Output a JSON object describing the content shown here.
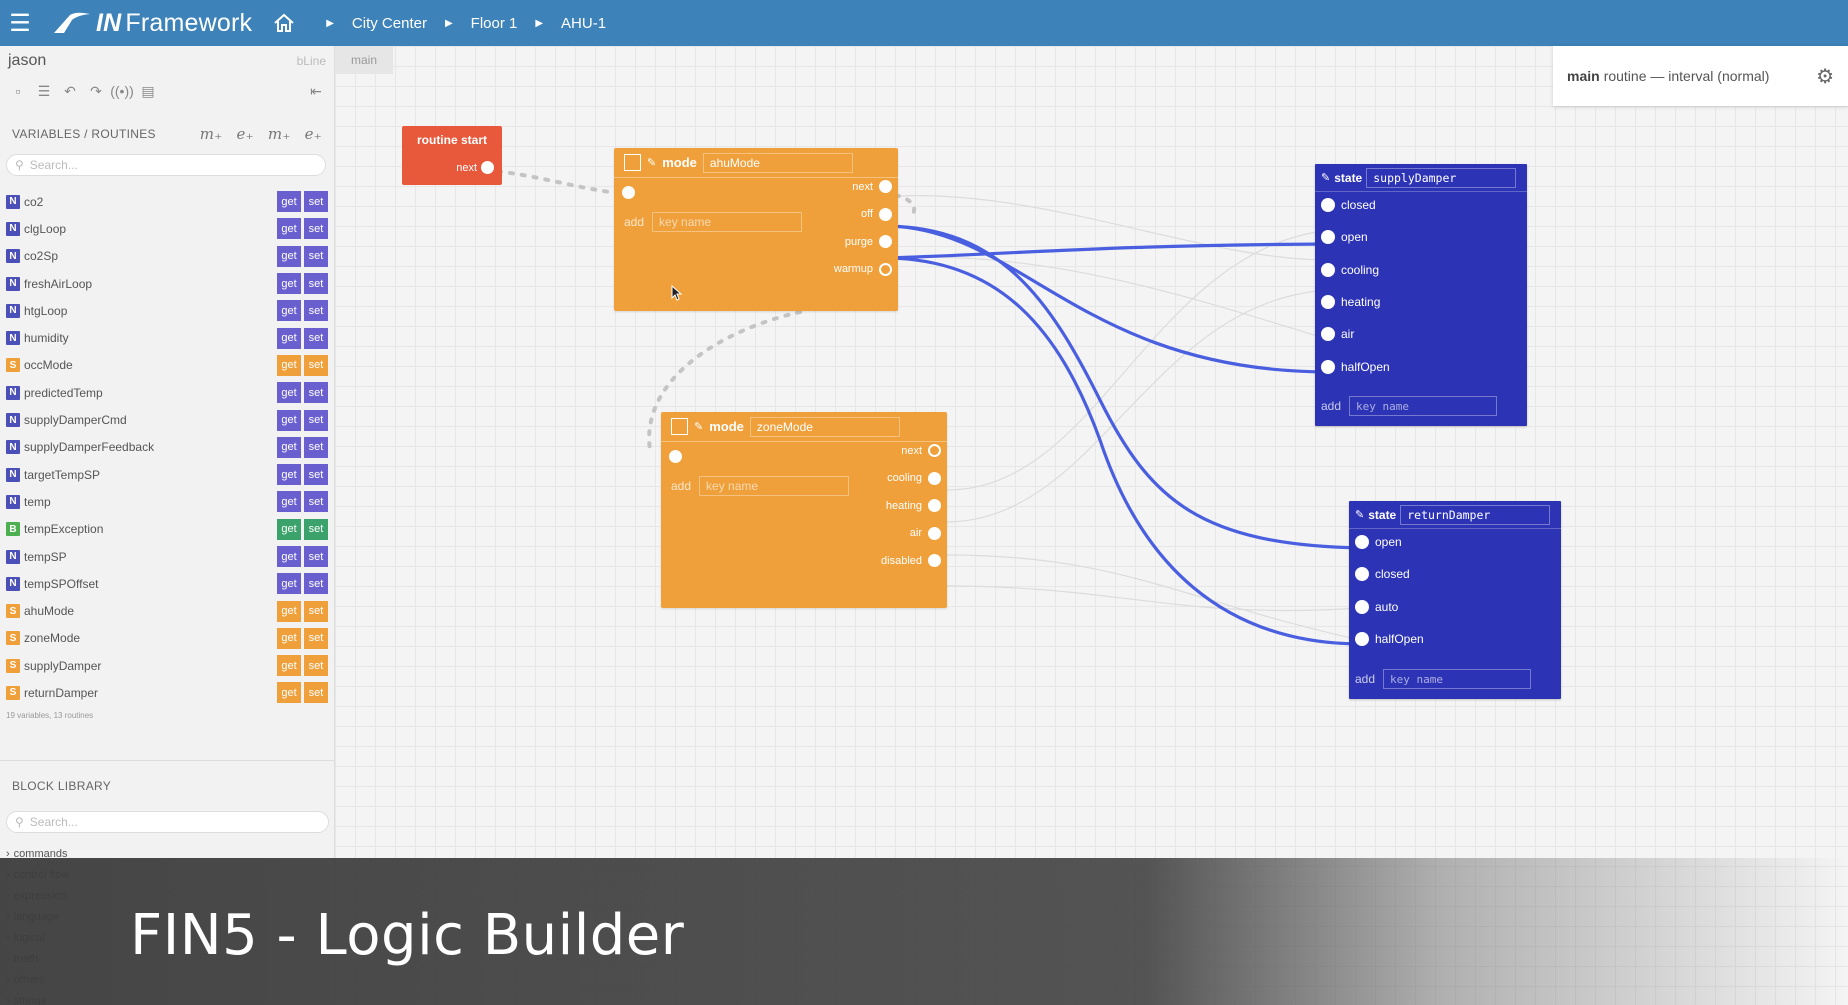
{
  "app": {
    "brand_in": "IN",
    "brand_rest": "Framework",
    "breadcrumbs": [
      "City Center",
      "Floor 1",
      "AHU-1"
    ]
  },
  "sidebar": {
    "username": "jason",
    "bline_label": "bLine",
    "vars_heading": "VARIABLES / ROUTINES",
    "search_placeholder": "Search...",
    "get_label": "get",
    "set_label": "set",
    "variables": [
      {
        "type": "N",
        "name": "co2"
      },
      {
        "type": "N",
        "name": "clgLoop"
      },
      {
        "type": "N",
        "name": "co2Sp"
      },
      {
        "type": "N",
        "name": "freshAirLoop"
      },
      {
        "type": "N",
        "name": "htgLoop"
      },
      {
        "type": "N",
        "name": "humidity"
      },
      {
        "type": "S",
        "name": "occMode"
      },
      {
        "type": "N",
        "name": "predictedTemp"
      },
      {
        "type": "N",
        "name": "supplyDamperCmd"
      },
      {
        "type": "N",
        "name": "supplyDamperFeedback"
      },
      {
        "type": "N",
        "name": "targetTempSP"
      },
      {
        "type": "N",
        "name": "temp"
      },
      {
        "type": "B",
        "name": "tempException"
      },
      {
        "type": "N",
        "name": "tempSP"
      },
      {
        "type": "N",
        "name": "tempSPOffset"
      },
      {
        "type": "S",
        "name": "ahuMode"
      },
      {
        "type": "S",
        "name": "zoneMode"
      },
      {
        "type": "S",
        "name": "supplyDamper"
      },
      {
        "type": "S",
        "name": "returnDamper"
      }
    ],
    "var_count": "19 variables, 13 routines",
    "library_heading": "BLOCK LIBRARY",
    "library_search_placeholder": "Search...",
    "library_categories": [
      "commands",
      "control flow",
      "expression",
      "language",
      "logical",
      "math",
      "others",
      "strings"
    ]
  },
  "canvas": {
    "tab_label": "main",
    "routine_info": {
      "bold": "main",
      "rest": "routine — interval (normal)"
    },
    "start_block": {
      "title": "routine start",
      "next_label": "next"
    },
    "ahu_block": {
      "keyword": "mode",
      "name": "ahuMode",
      "add_label": "add",
      "key_placeholder": "key name",
      "outputs": [
        "next",
        "off",
        "purge",
        "warmup"
      ]
    },
    "zone_block": {
      "keyword": "mode",
      "name": "zoneMode",
      "add_label": "add",
      "key_placeholder": "key name",
      "outputs": [
        "next",
        "cooling",
        "heating",
        "air",
        "disabled"
      ]
    },
    "supply_block": {
      "keyword": "state",
      "name": "supplyDamper",
      "states": [
        "closed",
        "open",
        "cooling",
        "heating",
        "air",
        "halfOpen"
      ],
      "add_label": "add",
      "key_placeholder": "key name"
    },
    "return_block": {
      "keyword": "state",
      "name": "returnDamper",
      "states": [
        "open",
        "closed",
        "auto",
        "halfOpen"
      ],
      "add_label": "add",
      "key_placeholder": "key name"
    }
  },
  "caption": "FIN5 - Logic Builder",
  "colors": {
    "topbar": "#3d82b8",
    "type_N": "#4b4fb8",
    "type_S": "#f0a03a",
    "type_B": "#4caf50",
    "mode_block": "#f0a03a",
    "state_block": "#2c33b4",
    "start_block": "#e8583a",
    "wire": "#4a5fe0"
  }
}
